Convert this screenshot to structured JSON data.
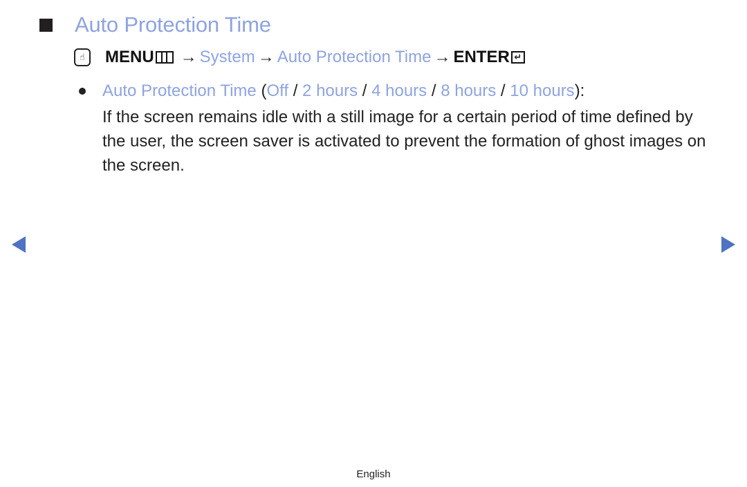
{
  "title": "Auto Protection Time",
  "path": {
    "menu": "MENU",
    "arrow": "→",
    "items": [
      "System",
      "Auto Protection Time"
    ],
    "enter": "ENTER",
    "enter_symbol": "↵"
  },
  "option": {
    "label": "Auto Protection Time",
    "open_paren": " (",
    "separator": " / ",
    "values": [
      "Off",
      "2 hours",
      "4 hours",
      "8 hours",
      "10 hours"
    ],
    "close": "):"
  },
  "description": "If the screen remains idle with a still image for a certain period of time defined by the user, the screen saver is activated to prevent the formation of ghost images on the screen.",
  "footer": {
    "language": "English"
  },
  "icons": {
    "om": "☝",
    "prev": "previous-page-icon",
    "next": "next-page-icon"
  },
  "colors": {
    "accent": "#8ea3e0",
    "nav": "#4e73c2"
  }
}
